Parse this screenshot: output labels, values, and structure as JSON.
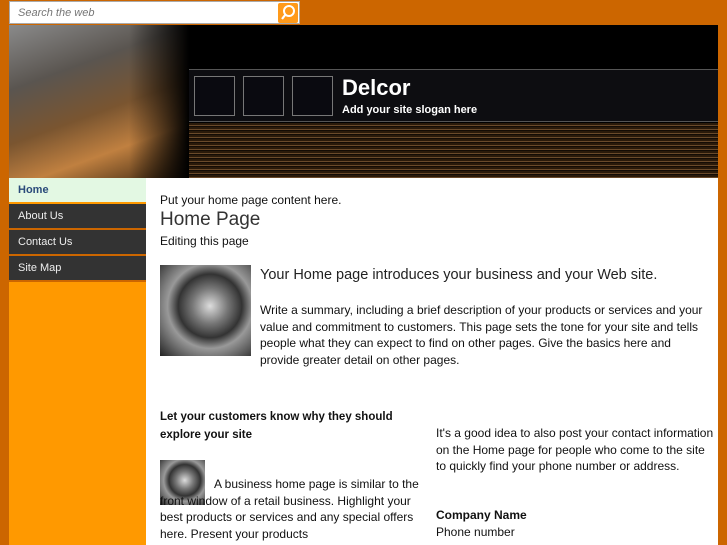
{
  "search": {
    "placeholder": "Search the web",
    "icon": "search-icon"
  },
  "header": {
    "title": "Delcor",
    "slogan": "Add your site slogan here"
  },
  "sidebar": {
    "items": [
      {
        "label": "Home"
      },
      {
        "label": "About Us"
      },
      {
        "label": "Contact Us"
      },
      {
        "label": "Site Map"
      }
    ]
  },
  "main": {
    "intro": "Put your home page content here.",
    "heading": "Home Page",
    "subheading": "Editing this page",
    "lead": "Your Home page introduces your business and your Web site.",
    "summary": "Write a summary, including a brief description of your products or services and your value and commitment to customers. This page sets the tone for your site and tells people what they can expect to find on other pages. Give the basics here and provide greater detail on other pages.",
    "left_heading": "Let your customers know why they should explore your site",
    "left_text": "A business home page is similar to the front window of a retail business. Highlight your best products or services and any special offers here. Present your products",
    "right_text": "It's a good idea to also post your contact information on the Home page for people who come to the site to quickly find your phone number or address.",
    "company_name": "Company Name",
    "phone": "Phone number"
  }
}
